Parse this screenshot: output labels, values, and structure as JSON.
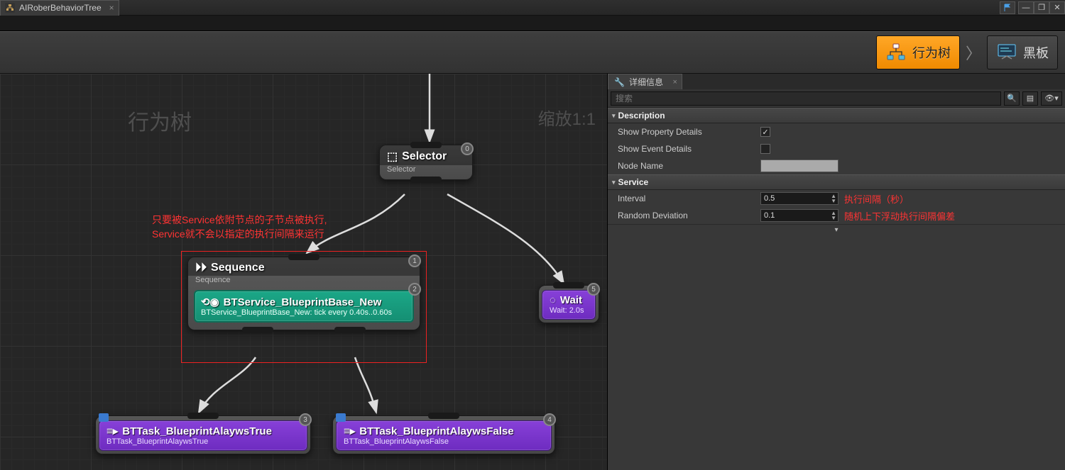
{
  "tab": {
    "title": "AIRoberBehaviorTree"
  },
  "modes": {
    "behavior_tree": "行为树",
    "blackboard": "黑板"
  },
  "graph": {
    "overlay_title": "行为树",
    "zoom_label": "缩放1:1",
    "annotation_line1": "只要被Service依附节点的子节点被执行,",
    "annotation_line2": "Service就不会以指定的执行间隔来运行",
    "selector": {
      "title": "Selector",
      "subtitle": "Selector",
      "index": "0"
    },
    "sequence": {
      "title": "Sequence",
      "subtitle": "Sequence",
      "index_top": "1",
      "index_bot": "2",
      "service_title": "BTService_BlueprintBase_New",
      "service_detail": "BTService_BlueprintBase_New: tick every 0.40s..0.60s"
    },
    "wait": {
      "title": "Wait",
      "detail": "Wait: 2.0s",
      "index": "5"
    },
    "task_true": {
      "title": "BTTask_BlueprintAlaywsTrue",
      "detail": "BTTask_BlueprintAlaywsTrue",
      "index": "3"
    },
    "task_false": {
      "title": "BTTask_BlueprintAlaywsFalse",
      "detail": "BTTask_BlueprintAlaywsFalse",
      "index": "4"
    }
  },
  "details": {
    "panel_title": "详细信息",
    "search_placeholder": "搜索",
    "sections": {
      "description": {
        "header": "Description",
        "show_property": "Show Property Details",
        "show_event": "Show Event Details",
        "node_name": "Node Name"
      },
      "service": {
        "header": "Service",
        "interval_label": "Interval",
        "interval_value": "0.5",
        "interval_anno": "执行间隔（秒）",
        "deviation_label": "Random Deviation",
        "deviation_value": "0.1",
        "deviation_anno": "随机上下浮动执行间隔偏差"
      }
    }
  }
}
